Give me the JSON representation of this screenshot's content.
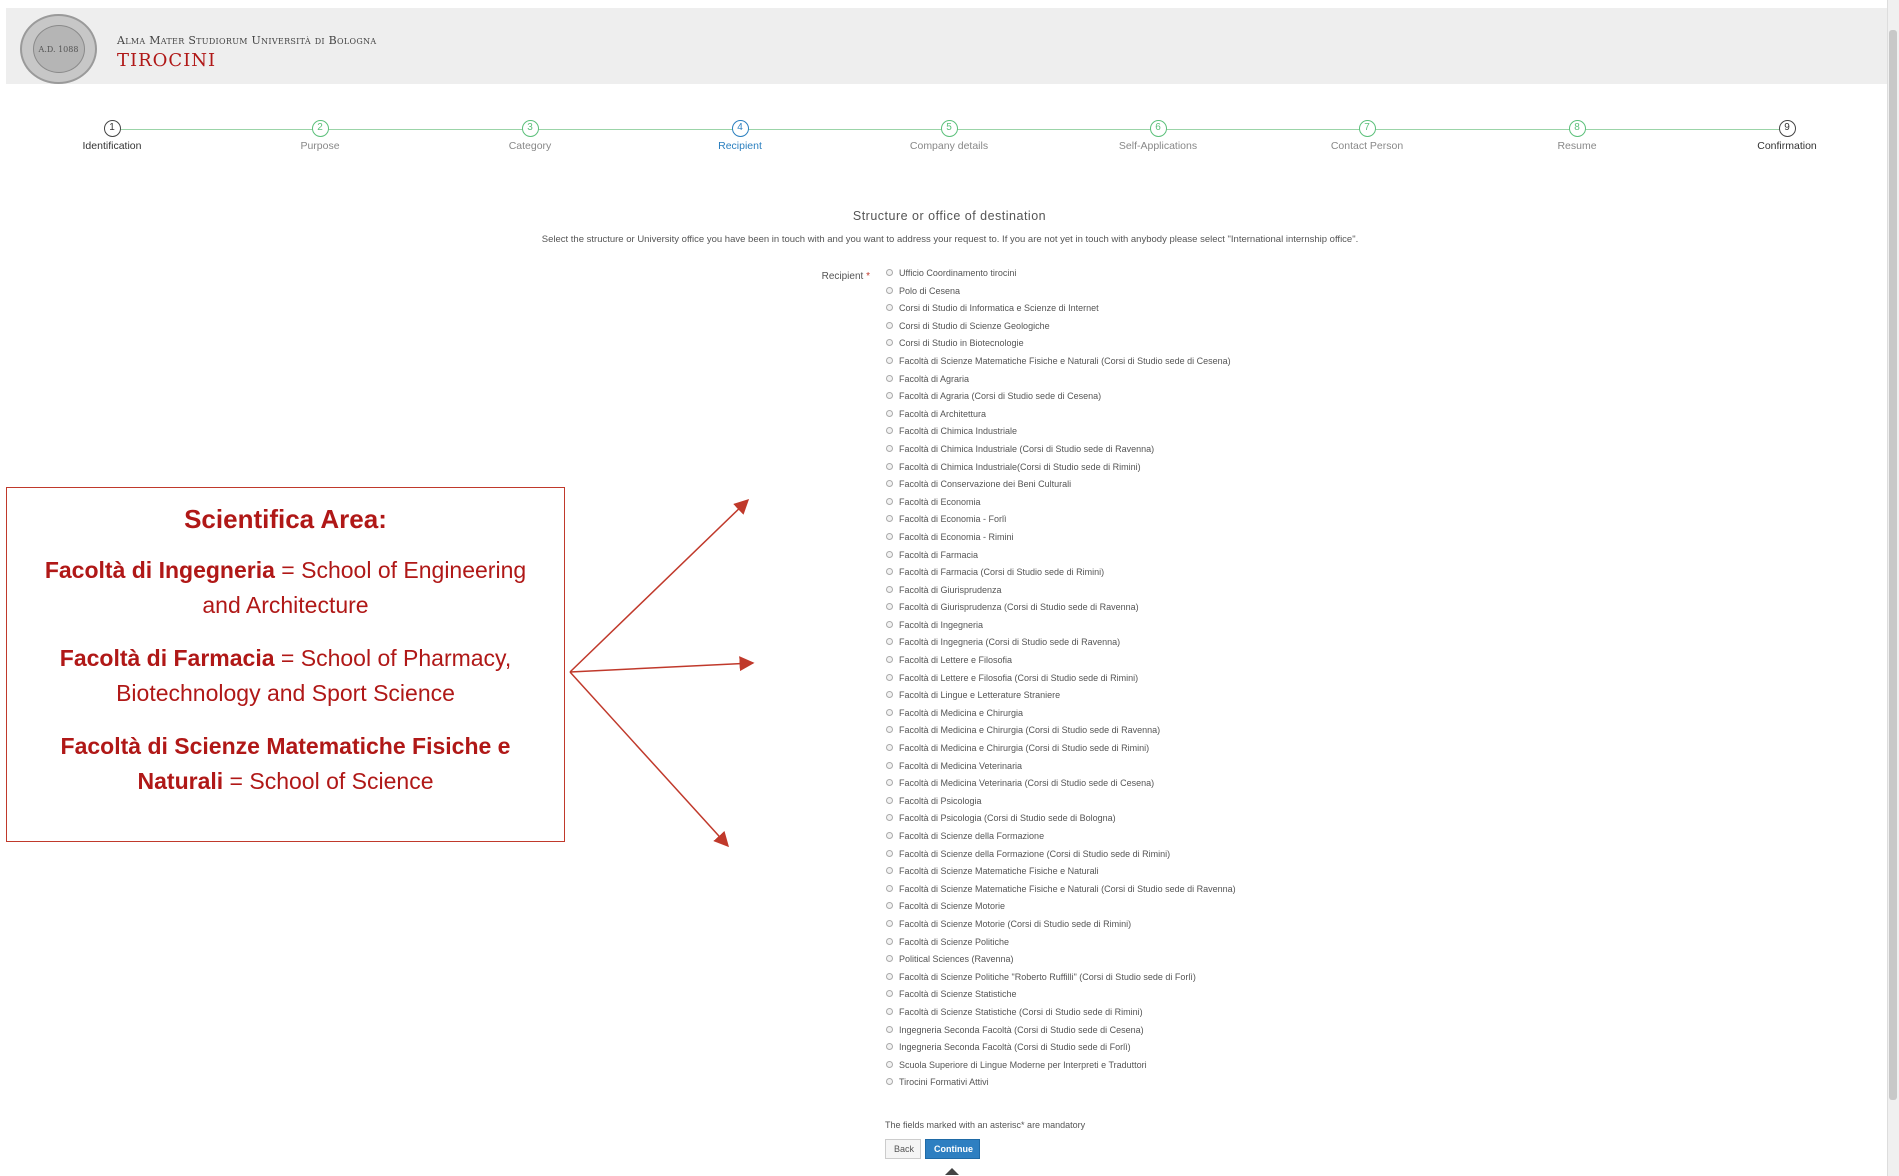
{
  "header": {
    "university": "Alma Mater Studiorum Università di Bologna",
    "title": "TIROCINI",
    "logo_text": "A.D. 1088"
  },
  "steps": [
    {
      "num": "1",
      "label": "Identification",
      "state": "done"
    },
    {
      "num": "2",
      "label": "Purpose",
      "state": "todo"
    },
    {
      "num": "3",
      "label": "Category",
      "state": "todo"
    },
    {
      "num": "4",
      "label": "Recipient",
      "state": "current"
    },
    {
      "num": "5",
      "label": "Company details",
      "state": "todo"
    },
    {
      "num": "6",
      "label": "Self-Applications",
      "state": "todo"
    },
    {
      "num": "7",
      "label": "Contact Person",
      "state": "todo"
    },
    {
      "num": "8",
      "label": "Resume",
      "state": "todo"
    },
    {
      "num": "9",
      "label": "Confirmation",
      "state": "done"
    }
  ],
  "form": {
    "heading": "Structure or office of destination",
    "intro": "Select the structure or University office you have been in touch with and you want to address your request to. If you are not yet in touch with anybody please select \"International internship office\".",
    "recipient_label": "Recipient",
    "required_mark": "*",
    "options": [
      "Ufficio Coordinamento tirocini",
      "Polo di Cesena",
      "Corsi di Studio di Informatica e Scienze di Internet",
      "Corsi di Studio di Scienze Geologiche",
      "Corsi di Studio in Biotecnologie",
      "Facoltà di Scienze Matematiche Fisiche e Naturali (Corsi di Studio sede di Cesena)",
      "Facoltà di Agraria",
      "Facoltà di Agraria (Corsi di Studio sede di Cesena)",
      "Facoltà di Architettura",
      "Facoltà di Chimica Industriale",
      "Facoltà di Chimica Industriale (Corsi di Studio sede di Ravenna)",
      "Facoltà di Chimica Industriale(Corsi di Studio sede di Rimini)",
      "Facoltà di Conservazione dei Beni Culturali",
      "Facoltà di Economia",
      "Facoltà di Economia - Forlì",
      "Facoltà di Economia - Rimini",
      "Facoltà di Farmacia",
      "Facoltà di Farmacia (Corsi di Studio sede di Rimini)",
      "Facoltà di Giurisprudenza",
      "Facoltà di Giurisprudenza (Corsi di Studio sede di Ravenna)",
      "Facoltà di Ingegneria",
      "Facoltà di Ingegneria (Corsi di Studio sede di Ravenna)",
      "Facoltà di Lettere e Filosofia",
      "Facoltà di Lettere e Filosofia (Corsi di Studio sede di Rimini)",
      "Facoltà di Lingue e Letterature Straniere",
      "Facoltà di Medicina e Chirurgia",
      "Facoltà di Medicina e Chirurgia (Corsi di Studio sede di Ravenna)",
      "Facoltà di Medicina e Chirurgia (Corsi di Studio sede di Rimini)",
      "Facoltà di Medicina Veterinaria",
      "Facoltà di Medicina Veterinaria (Corsi di Studio sede di Cesena)",
      "Facoltà di Psicologia",
      "Facoltà di Psicologia (Corsi di Studio sede di Bologna)",
      "Facoltà di Scienze della Formazione",
      "Facoltà di Scienze della Formazione (Corsi di Studio sede di Rimini)",
      "Facoltà di Scienze Matematiche Fisiche e Naturali",
      "Facoltà di Scienze Matematiche Fisiche e Naturali (Corsi di Studio sede di Ravenna)",
      "Facoltà di Scienze Motorie",
      "Facoltà di Scienze Motorie (Corsi di Studio sede di Rimini)",
      "Facoltà di Scienze Politiche",
      "Political Sciences (Ravenna)",
      "Facoltà di Scienze Politiche \"Roberto Ruffilli\" (Corsi di Studio sede di Forlì)",
      "Facoltà di Scienze Statistiche",
      "Facoltà di Scienze Statistiche (Corsi di Studio sede di Rimini)",
      "Ingegneria Seconda Facoltà (Corsi di Studio sede di Cesena)",
      "Ingegneria Seconda Facoltà (Corsi di Studio sede di Forlì)",
      "Scuola Superiore di Lingue Moderne per Interpreti e Traduttori",
      "Tirocini Formativi Attivi"
    ],
    "mandatory_note": "The fields marked with an asterisc* are mandatory",
    "back_label": "Back",
    "continue_label": "Continue"
  },
  "annotation": {
    "title": "Scientifica Area:",
    "items": [
      {
        "bold": "Facoltà di Ingegneria",
        "rest": " = School of Engineering and Architecture"
      },
      {
        "bold": "Facoltà di Farmacia",
        "rest": " = School of Pharmacy, Biotechnology and Sport Science"
      },
      {
        "bold": "Facoltà di Scienze Matematiche Fisiche e Naturali",
        "rest": " = School of Science"
      }
    ]
  },
  "colors": {
    "brand_red": "#b01817",
    "step_green": "#5bc07a",
    "step_current": "#2a7fbf",
    "button_blue": "#2e7fc1"
  },
  "icons": [
    "university-seal-icon",
    "radio-icon",
    "scroll-top-icon",
    "arrow-icon"
  ]
}
